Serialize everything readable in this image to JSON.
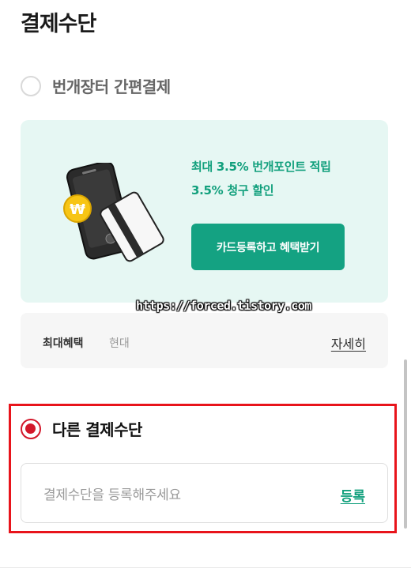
{
  "section_title": "결제수단",
  "option_easy_pay": {
    "label": "번개장터 간편결제",
    "selected": false
  },
  "promo": {
    "line1": "최대 3.5% 번개포인트 적립",
    "line2": "3.5% 청구 할인",
    "button_label": "카드등록하고 혜택받기",
    "coin_symbol": "₩",
    "accent_color": "#12a07d",
    "background_color": "#e6f7f3"
  },
  "benefit": {
    "label": "최대혜택",
    "value": "현대",
    "link_label": "자세히"
  },
  "watermark": "https://forced.tistory.com",
  "option_other": {
    "label": "다른 결제수단",
    "selected": true,
    "accent_color": "#d3182b"
  },
  "payment_input": {
    "placeholder": "결제수단을 등록해주세요",
    "register_label": "등록"
  }
}
